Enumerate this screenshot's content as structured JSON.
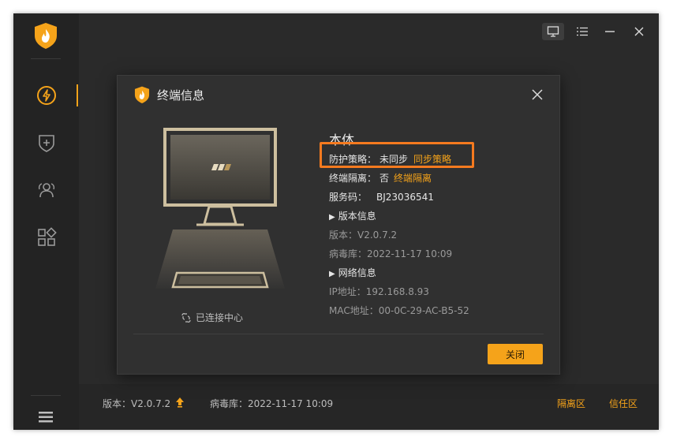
{
  "window": {
    "controls": [
      {
        "name": "mini-mode-icon"
      },
      {
        "name": "menu-list-icon"
      },
      {
        "name": "minimize-icon"
      },
      {
        "name": "close-icon"
      }
    ]
  },
  "sidebar": {
    "items": [
      {
        "icon": "lightning-icon",
        "active": true
      },
      {
        "icon": "shield-plus-icon",
        "active": false
      },
      {
        "icon": "users-icon",
        "active": false
      },
      {
        "icon": "apps-grid-icon",
        "active": false
      }
    ]
  },
  "dialog": {
    "title": "终端信息",
    "heading": "本体",
    "policy_label": "防护策略：",
    "policy_value": "未同步",
    "policy_link": "同步策略",
    "isolation_label": "终端隔离：",
    "isolation_value": "否",
    "isolation_link": "终端隔离",
    "service_label": "服务码：",
    "service_value": "BJ23036541",
    "version_section": "版本信息",
    "version_line": "版本：V2.0.7.2",
    "virus_db_line": "病毒库：2022-11-17 10:09",
    "network_section": "网络信息",
    "ip_line": "IP地址：192.168.8.93",
    "mac_line": "MAC地址：00-0C-29-AC-B5-52",
    "connected_text": "已连接中心",
    "close_button": "关闭"
  },
  "footer": {
    "version": "版本：V2.0.7.2",
    "virus_db": "病毒库：2022-11-17 10:09",
    "quarantine": "隔离区",
    "trust_zone": "信任区"
  },
  "colors": {
    "accent": "#f5a31a",
    "highlight_box": "#f57a1f",
    "background": "#2a2a2a"
  }
}
